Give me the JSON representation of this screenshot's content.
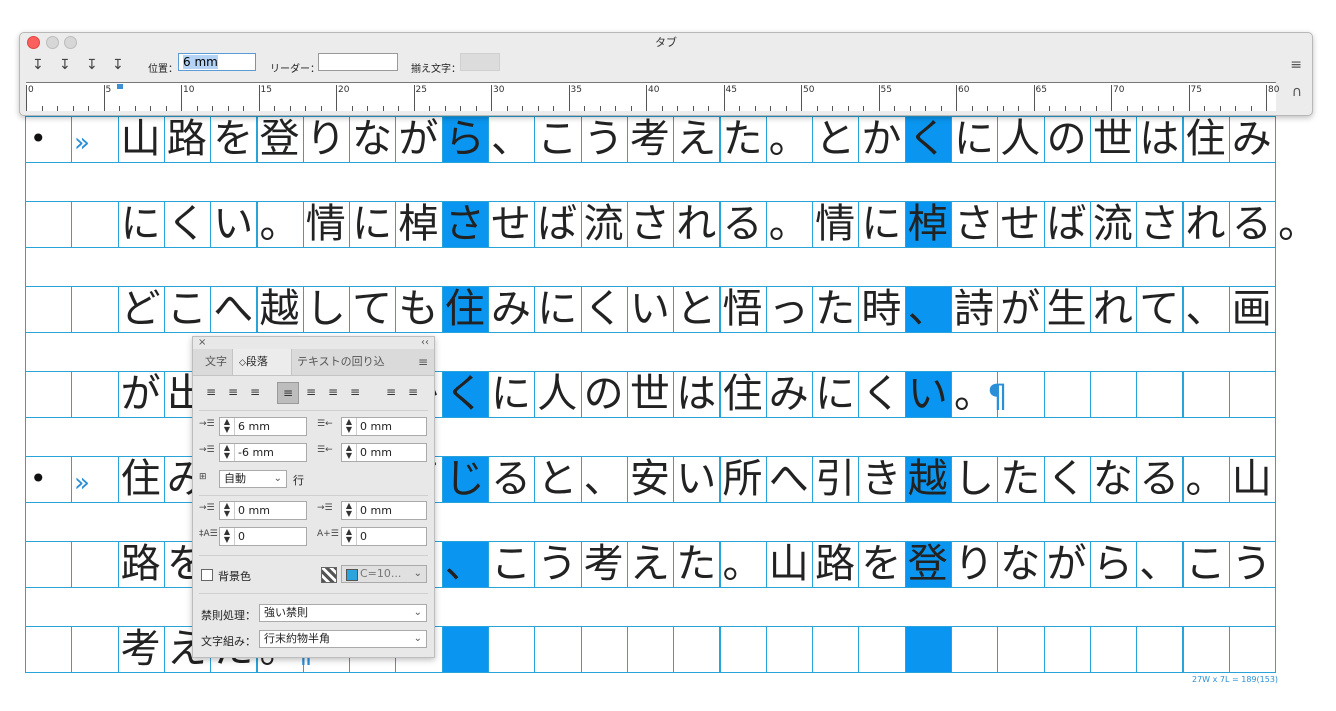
{
  "tab_window": {
    "title": "タブ",
    "position_label": "位置：",
    "position_value": "6 mm",
    "leader_label": "リーダー：",
    "leader_value": "",
    "align_on_label": "揃え文字：",
    "align_on_value": "",
    "ruler_numbers": [
      "0",
      "5",
      "10",
      "15",
      "20",
      "25",
      "30",
      "35",
      "40",
      "45",
      "50",
      "55",
      "60",
      "65",
      "70",
      "75",
      "80"
    ]
  },
  "document": {
    "lines": [
      "山路を登りながら、こう考えた。とかくに人の世は住み",
      "にくい。情に棹させば流される。情に棹させば流される。",
      "どこへ越しても住みにくいと悟った時、詩が生れて、画",
      "が出来る。とかくに人の世は住みにくい。",
      "住みにくさが高じると、安い所へ引き越したくなる。山",
      "路を登りながら、こう考えた。山路を登りながら、こう",
      "考えた。"
    ],
    "bullet": "•",
    "tab_marker": "»",
    "pilcrow": "¶",
    "grid_caption": "27W x 7L = 189(153)"
  },
  "panel": {
    "tabs": [
      "文字",
      "段落",
      "テキストの回り込"
    ],
    "active_tab": "段落",
    "left_indent": "6 mm",
    "first_line_indent": "-6 mm",
    "right_indent": "0 mm",
    "last_line_indent": "0 mm",
    "leading": "自動",
    "leading_unit": "行",
    "space_before": "0 mm",
    "space_after": "0 mm",
    "drop_cap_lines": "0",
    "drop_cap_chars": "0",
    "shading_label": "背景色",
    "shading_color": "C=10...",
    "kinsoku_label": "禁則処理：",
    "kinsoku_value": "強い禁則",
    "mojikumi_label": "文字組み：",
    "mojikumi_value": "行末約物半角",
    "accent_color": "#2ba3dc",
    "highlight_color": "#0a96f0"
  }
}
